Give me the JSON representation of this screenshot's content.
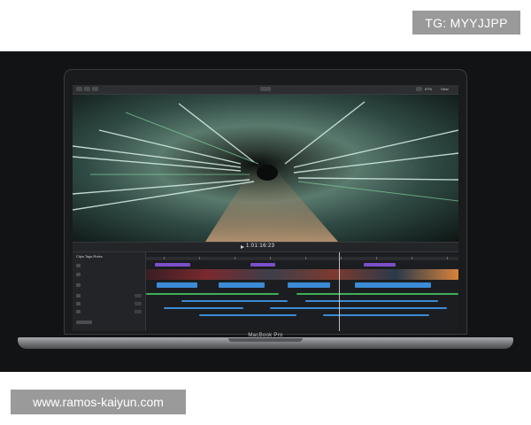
{
  "watermarks": {
    "top_right": "TG: MYYJJPP",
    "bottom_left": "www.ramos-kaiyun.com"
  },
  "laptop": {
    "model_label": "MacBook Pro"
  },
  "fcp": {
    "timecode": "1:01:16:23",
    "zoom": "57%",
    "view": "View",
    "library_tabs": "Clips  Tags  Roles"
  },
  "colors": {
    "scene_bg": "#121314",
    "clip_blue": "#3b8bd6",
    "clip_purple": "#7b4fc9",
    "clip_green": "#3fae5a",
    "clip_orange": "#d8833a"
  },
  "icons": {
    "play": "play-icon"
  }
}
